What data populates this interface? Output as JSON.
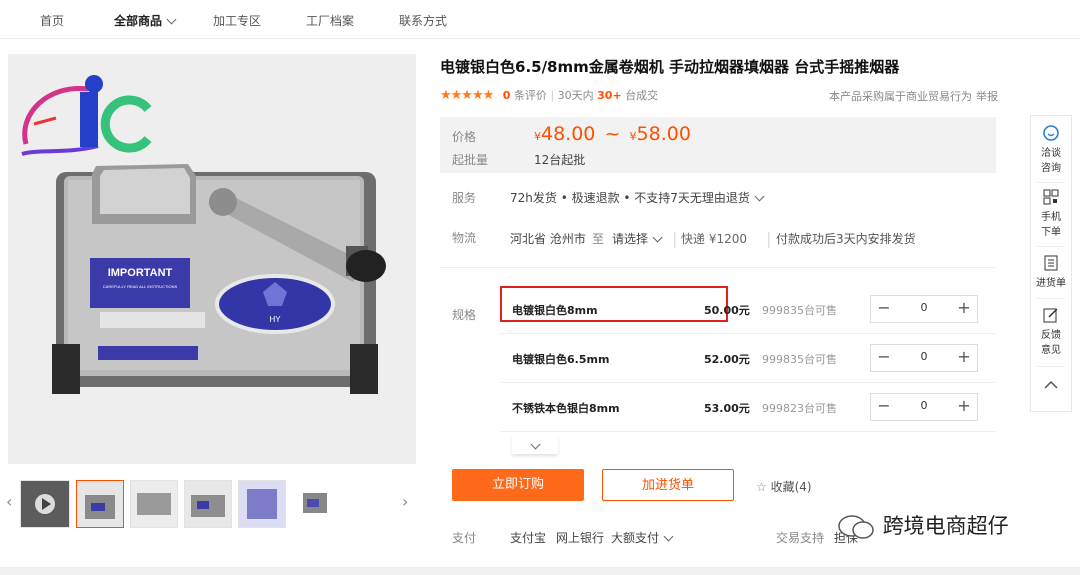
{
  "nav": {
    "items": [
      "首页",
      "全部商品",
      "加工专区",
      "工厂档案",
      "联系方式"
    ]
  },
  "product": {
    "title": "电镀银白色6.5/8mm金属卷烟机 手动拉烟器填烟器 台式手摇推烟器",
    "reviews_count": "0",
    "reviews_label": "条评价",
    "sales_prefix": "30天内",
    "sales_count": "30+",
    "sales_suffix": "台成交",
    "notice": "本产品采购属于商业贸易行为",
    "report": "举报",
    "image_brand": "HY",
    "image_plate_title": "IMPORTANT",
    "image_plate_note": "CAREFULLY READ ALL INSTRUCTIONS"
  },
  "price": {
    "label": "价格",
    "low": "48.00",
    "high": "58.00",
    "currency": "¥",
    "range_sep": "~",
    "moq_label": "起批量",
    "moq_value": "12台起批"
  },
  "service": {
    "label": "服务",
    "value": "72h发货 • 极速退款 • 不支持7天无理由退货"
  },
  "logistics": {
    "label": "物流",
    "origin": "河北省 沧州市",
    "to": "至",
    "dest": "请选择",
    "express": "快递 ¥1200",
    "ship": "付款成功后3天内安排发货"
  },
  "specs": {
    "label": "规格",
    "rows": [
      {
        "name": "电镀银白色8mm",
        "price": "50.00元",
        "stock": "999835台可售",
        "qty": "0",
        "minus": "−",
        "plus": "+"
      },
      {
        "name": "电镀银白色6.5mm",
        "price": "52.00元",
        "stock": "999835台可售",
        "qty": "0",
        "minus": "−",
        "plus": "+"
      },
      {
        "name": "不锈铁本色银白8mm",
        "price": "53.00元",
        "stock": "999823台可售",
        "qty": "0",
        "minus": "−",
        "plus": "+"
      }
    ]
  },
  "actions": {
    "buy": "立即订购",
    "cart": "加进货单",
    "fav": "收藏(4)"
  },
  "payment": {
    "label": "支付",
    "methods": [
      "支付宝",
      "网上银行",
      "大额支付"
    ],
    "trade_label": "交易支持",
    "trade_value": "担保"
  },
  "sidebar": {
    "chat": [
      "洽谈",
      "咨询"
    ],
    "mobile": [
      "手机",
      "下单"
    ],
    "list": "进货单",
    "feedback": [
      "反馈",
      "意见"
    ]
  },
  "watermark": "跨境电商超仔",
  "colors": {
    "accent": "#ff5000",
    "highlight_box": "#e02020",
    "price_bg": "#f2f2f2"
  }
}
